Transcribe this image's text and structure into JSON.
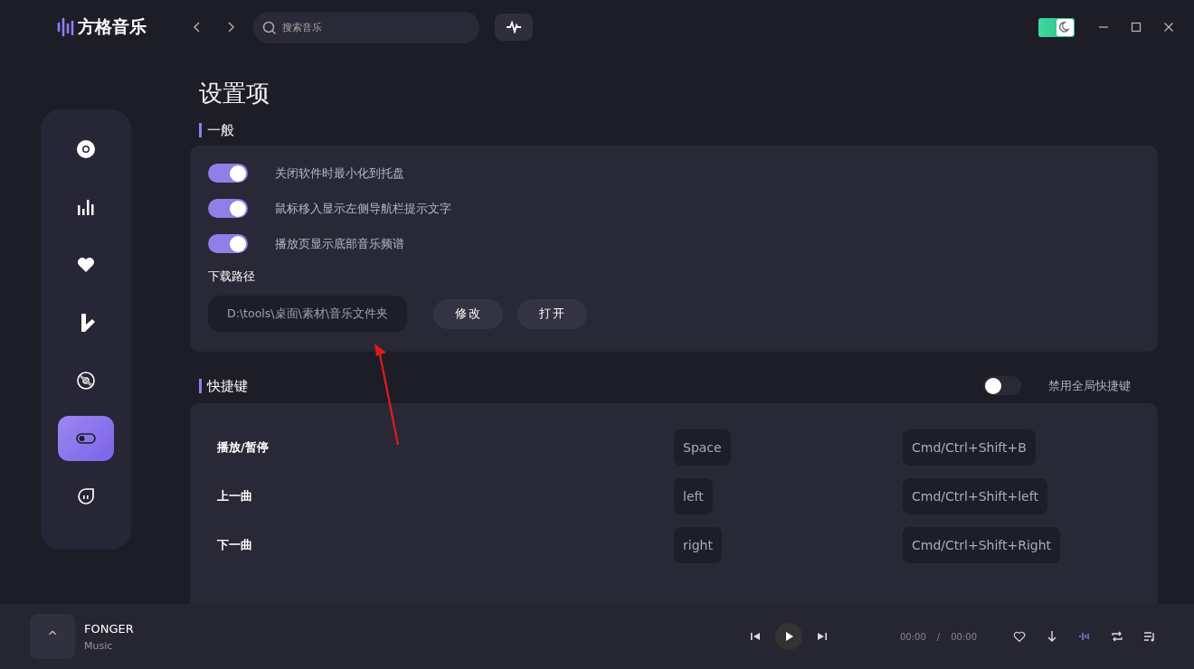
{
  "app": {
    "name": "方格音乐"
  },
  "header": {
    "search": {
      "placeholder": "搜索音乐"
    },
    "theme_toggle": {
      "on": true
    }
  },
  "sidebar": {
    "items": [
      {
        "kind": "disc",
        "selected": false
      },
      {
        "kind": "bars",
        "selected": false
      },
      {
        "kind": "heart",
        "selected": false
      },
      {
        "kind": "note",
        "selected": false
      },
      {
        "kind": "cd",
        "selected": false
      },
      {
        "kind": "toggle",
        "selected": true
      },
      {
        "kind": "bubble",
        "selected": false
      }
    ]
  },
  "page": {
    "title": "设置项"
  },
  "general": {
    "heading": "一般",
    "options": [
      {
        "label": "关闭软件时最小化到托盘",
        "on": true
      },
      {
        "label": "鼠标移入显示左侧导航栏提示文字",
        "on": true
      },
      {
        "label": "播放页显示底部音乐频谱",
        "on": true
      }
    ],
    "download_path": {
      "label": "下载路径",
      "value": "D:\\tools\\桌面\\素材\\音乐文件夹",
      "buttons": [
        "修改",
        "打开"
      ]
    }
  },
  "shortcuts": {
    "heading": "快捷键",
    "global_toggle": {
      "label": "禁用全局快捷键",
      "on": false
    },
    "rows": [
      {
        "action": "播放/暂停",
        "key": "Space",
        "global_key": "Cmd/Ctrl+Shift+B"
      },
      {
        "action": "上一曲",
        "key": "left",
        "global_key": "Cmd/Ctrl+Shift+left"
      },
      {
        "action": "下一曲",
        "key": "right",
        "global_key": "Cmd/Ctrl+Shift+Right"
      }
    ]
  },
  "player": {
    "cover_button": "^",
    "title": "FONGER",
    "artist": "Music",
    "current_time": "00:00",
    "separator": "/",
    "total_time": "00:00"
  }
}
